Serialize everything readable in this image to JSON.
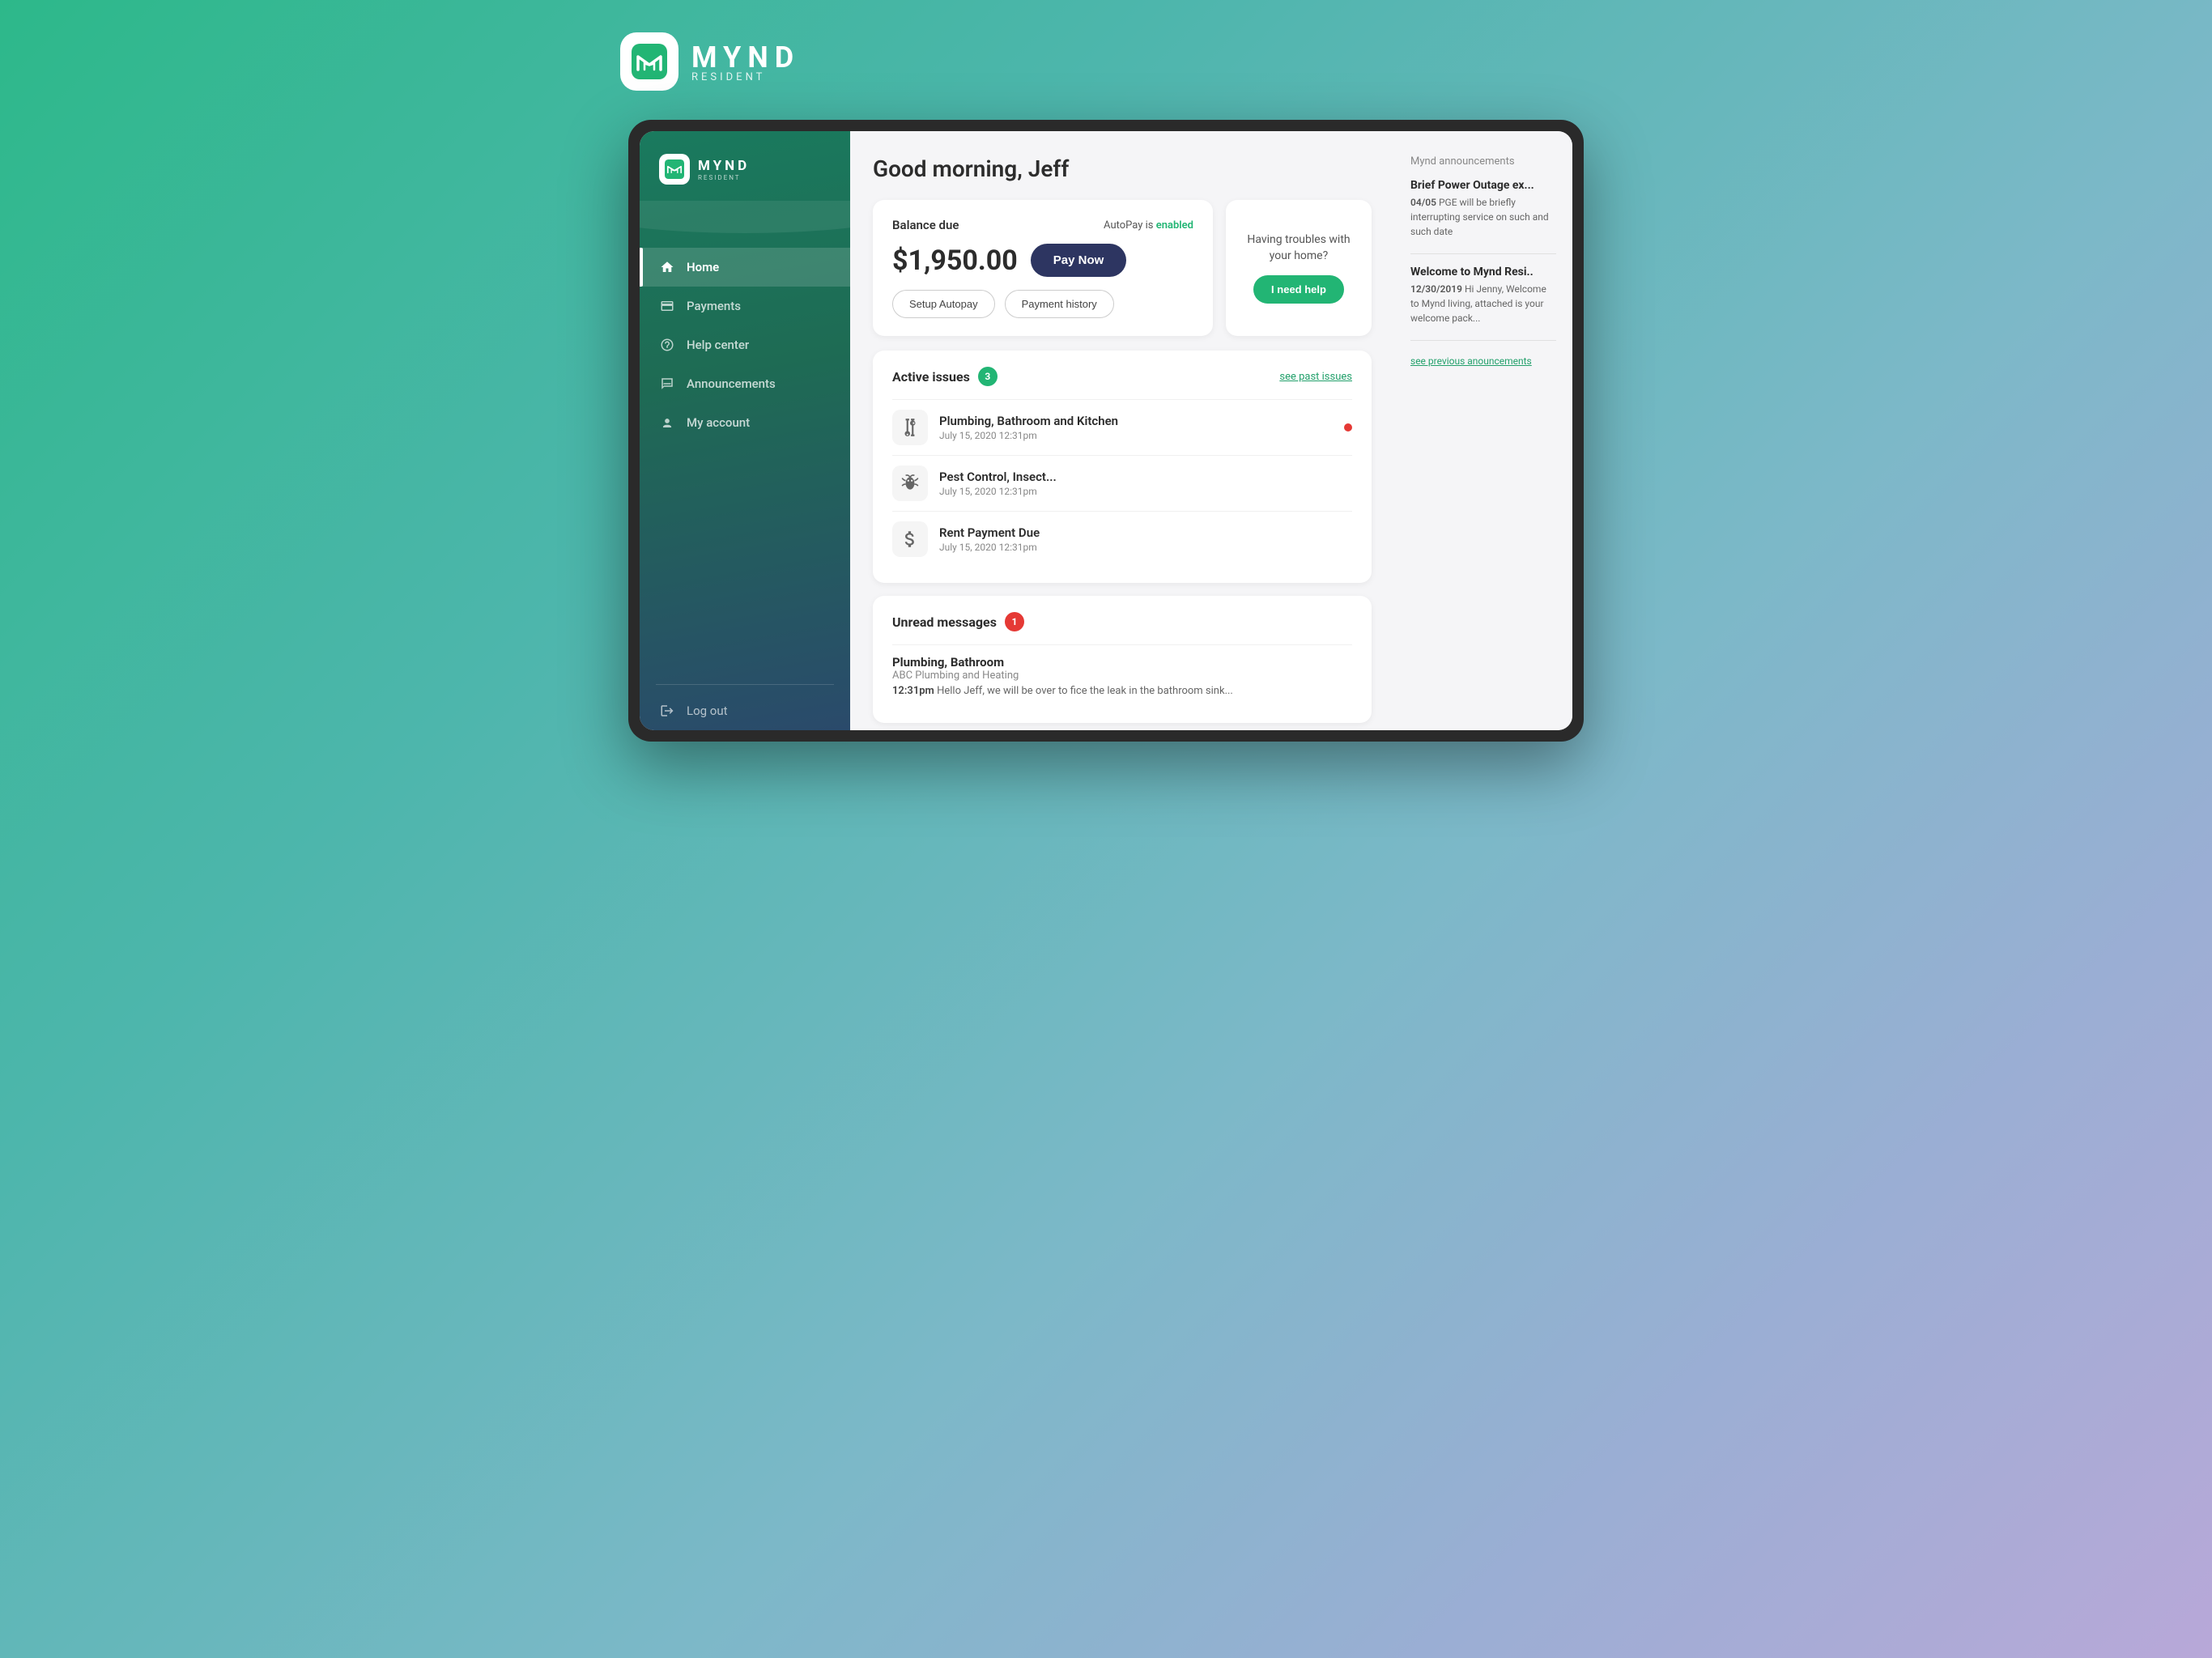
{
  "brand": {
    "logo_letter": "M",
    "name": "MYND",
    "subtitle": "RESIDENT"
  },
  "sidebar": {
    "logo_name": "MYND",
    "logo_subtitle": "RESIDENT",
    "nav_items": [
      {
        "id": "home",
        "label": "Home",
        "icon": "🏠",
        "active": true
      },
      {
        "id": "payments",
        "label": "Payments",
        "icon": "💳",
        "active": false
      },
      {
        "id": "help-center",
        "label": "Help center",
        "icon": "🧑",
        "active": false
      },
      {
        "id": "announcements",
        "label": "Announcements",
        "icon": "📢",
        "active": false
      },
      {
        "id": "my-account",
        "label": "My account",
        "icon": "⚙️",
        "active": false
      }
    ],
    "logout_label": "Log out"
  },
  "main": {
    "greeting": "Good morning, Jeff",
    "balance_card": {
      "label": "Balance due",
      "autopay_prefix": "AutoPay is",
      "autopay_status": "enabled",
      "amount": "$1,950.00",
      "pay_now_label": "Pay Now",
      "setup_autopay_label": "Setup Autopay",
      "payment_history_label": "Payment history"
    },
    "help_card": {
      "text": "Having troubles with your home?",
      "button_label": "I need help"
    },
    "active_issues": {
      "title": "Active issues",
      "count": "3",
      "see_past_label": "see past issues",
      "items": [
        {
          "title": "Plumbing, Bathroom and Kitchen",
          "date": "July 15, 2020 12:31pm",
          "icon": "🚰",
          "has_dot": true
        },
        {
          "title": "Pest Control, Insect...",
          "date": "July 15, 2020 12:31pm",
          "icon": "🐝",
          "has_dot": false
        },
        {
          "title": "Rent Payment Due",
          "date": "July 15, 2020 12:31pm",
          "icon": "💲",
          "has_dot": false
        }
      ]
    },
    "unread_messages": {
      "title": "Unread messages",
      "count": "1",
      "items": [
        {
          "sender": "Plumbing, Bathroom",
          "company": "ABC Plumbing and Heating",
          "time": "12:31pm",
          "preview": "Hello Jeff, we will be over to fice the leak in the bathroom sink..."
        }
      ]
    }
  },
  "announcements": {
    "section_title": "Mynd announcements",
    "items": [
      {
        "title": "Brief Power Outage ex...",
        "date": "04/05",
        "body": "PGE will be briefly interrupting service on such and such date"
      },
      {
        "title": "Welcome to Mynd Resi..",
        "date": "12/30/2019",
        "body": "Hi Jenny, Welcome to Mynd living, attached is your welcome pack..."
      }
    ],
    "see_prev_label": "see previous anouncements"
  }
}
